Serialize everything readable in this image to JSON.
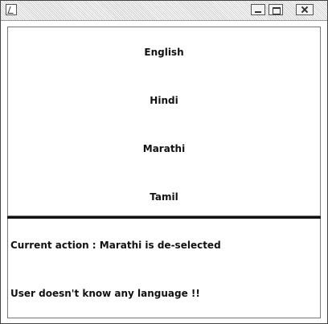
{
  "window": {
    "icons": [
      "app-icon",
      "minimize-icon",
      "maximize-icon",
      "close-icon"
    ]
  },
  "languages": [
    "English",
    "Hindi",
    "Marathi",
    "Tamil"
  ],
  "status": {
    "current_action": "Current action : Marathi is de-selected",
    "message": "User doesn't know any language !!"
  },
  "colors": {
    "background": "#ffffff",
    "text": "#111111",
    "divider": "#111111"
  }
}
